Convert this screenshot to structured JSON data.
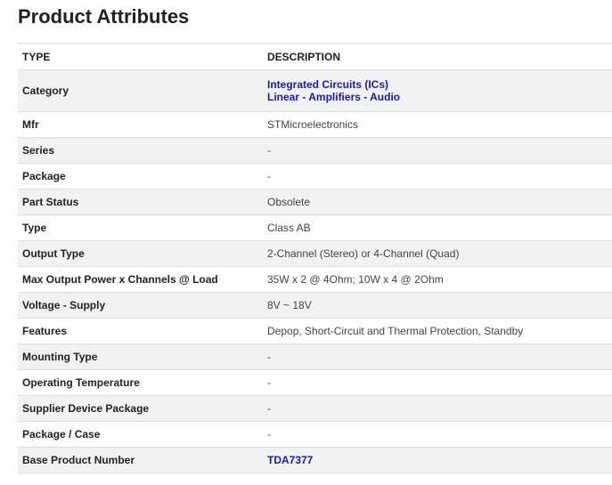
{
  "title": "Product Attributes",
  "columns": {
    "type": "TYPE",
    "description": "DESCRIPTION"
  },
  "rows": [
    {
      "type": "Category",
      "values": [
        "Integrated Circuits (ICs)",
        "Linear - Amplifiers - Audio"
      ],
      "link": true
    },
    {
      "type": "Mfr",
      "values": [
        "STMicroelectronics"
      ],
      "link": false
    },
    {
      "type": "Series",
      "values": [
        "-"
      ],
      "link": false
    },
    {
      "type": "Package",
      "values": [
        "-"
      ],
      "link": false
    },
    {
      "type": "Part Status",
      "values": [
        "Obsolete"
      ],
      "link": false
    },
    {
      "type": "Type",
      "values": [
        "Class AB"
      ],
      "link": false
    },
    {
      "type": "Output Type",
      "values": [
        "2-Channel (Stereo) or 4-Channel (Quad)"
      ],
      "link": false
    },
    {
      "type": "Max Output Power x Channels @ Load",
      "values": [
        "35W x 2 @ 4Ohm; 10W x 4 @ 2Ohm"
      ],
      "link": false
    },
    {
      "type": "Voltage - Supply",
      "values": [
        "8V ~ 18V"
      ],
      "link": false
    },
    {
      "type": "Features",
      "values": [
        "Depop, Short-Circuit and Thermal Protection, Standby"
      ],
      "link": false
    },
    {
      "type": "Mounting Type",
      "values": [
        "-"
      ],
      "link": false
    },
    {
      "type": "Operating Temperature",
      "values": [
        "-"
      ],
      "link": false
    },
    {
      "type": "Supplier Device Package",
      "values": [
        "-"
      ],
      "link": false
    },
    {
      "type": "Package / Case",
      "values": [
        "-"
      ],
      "link": false
    },
    {
      "type": "Base Product Number",
      "values": [
        "TDA7377"
      ],
      "link": true
    }
  ]
}
